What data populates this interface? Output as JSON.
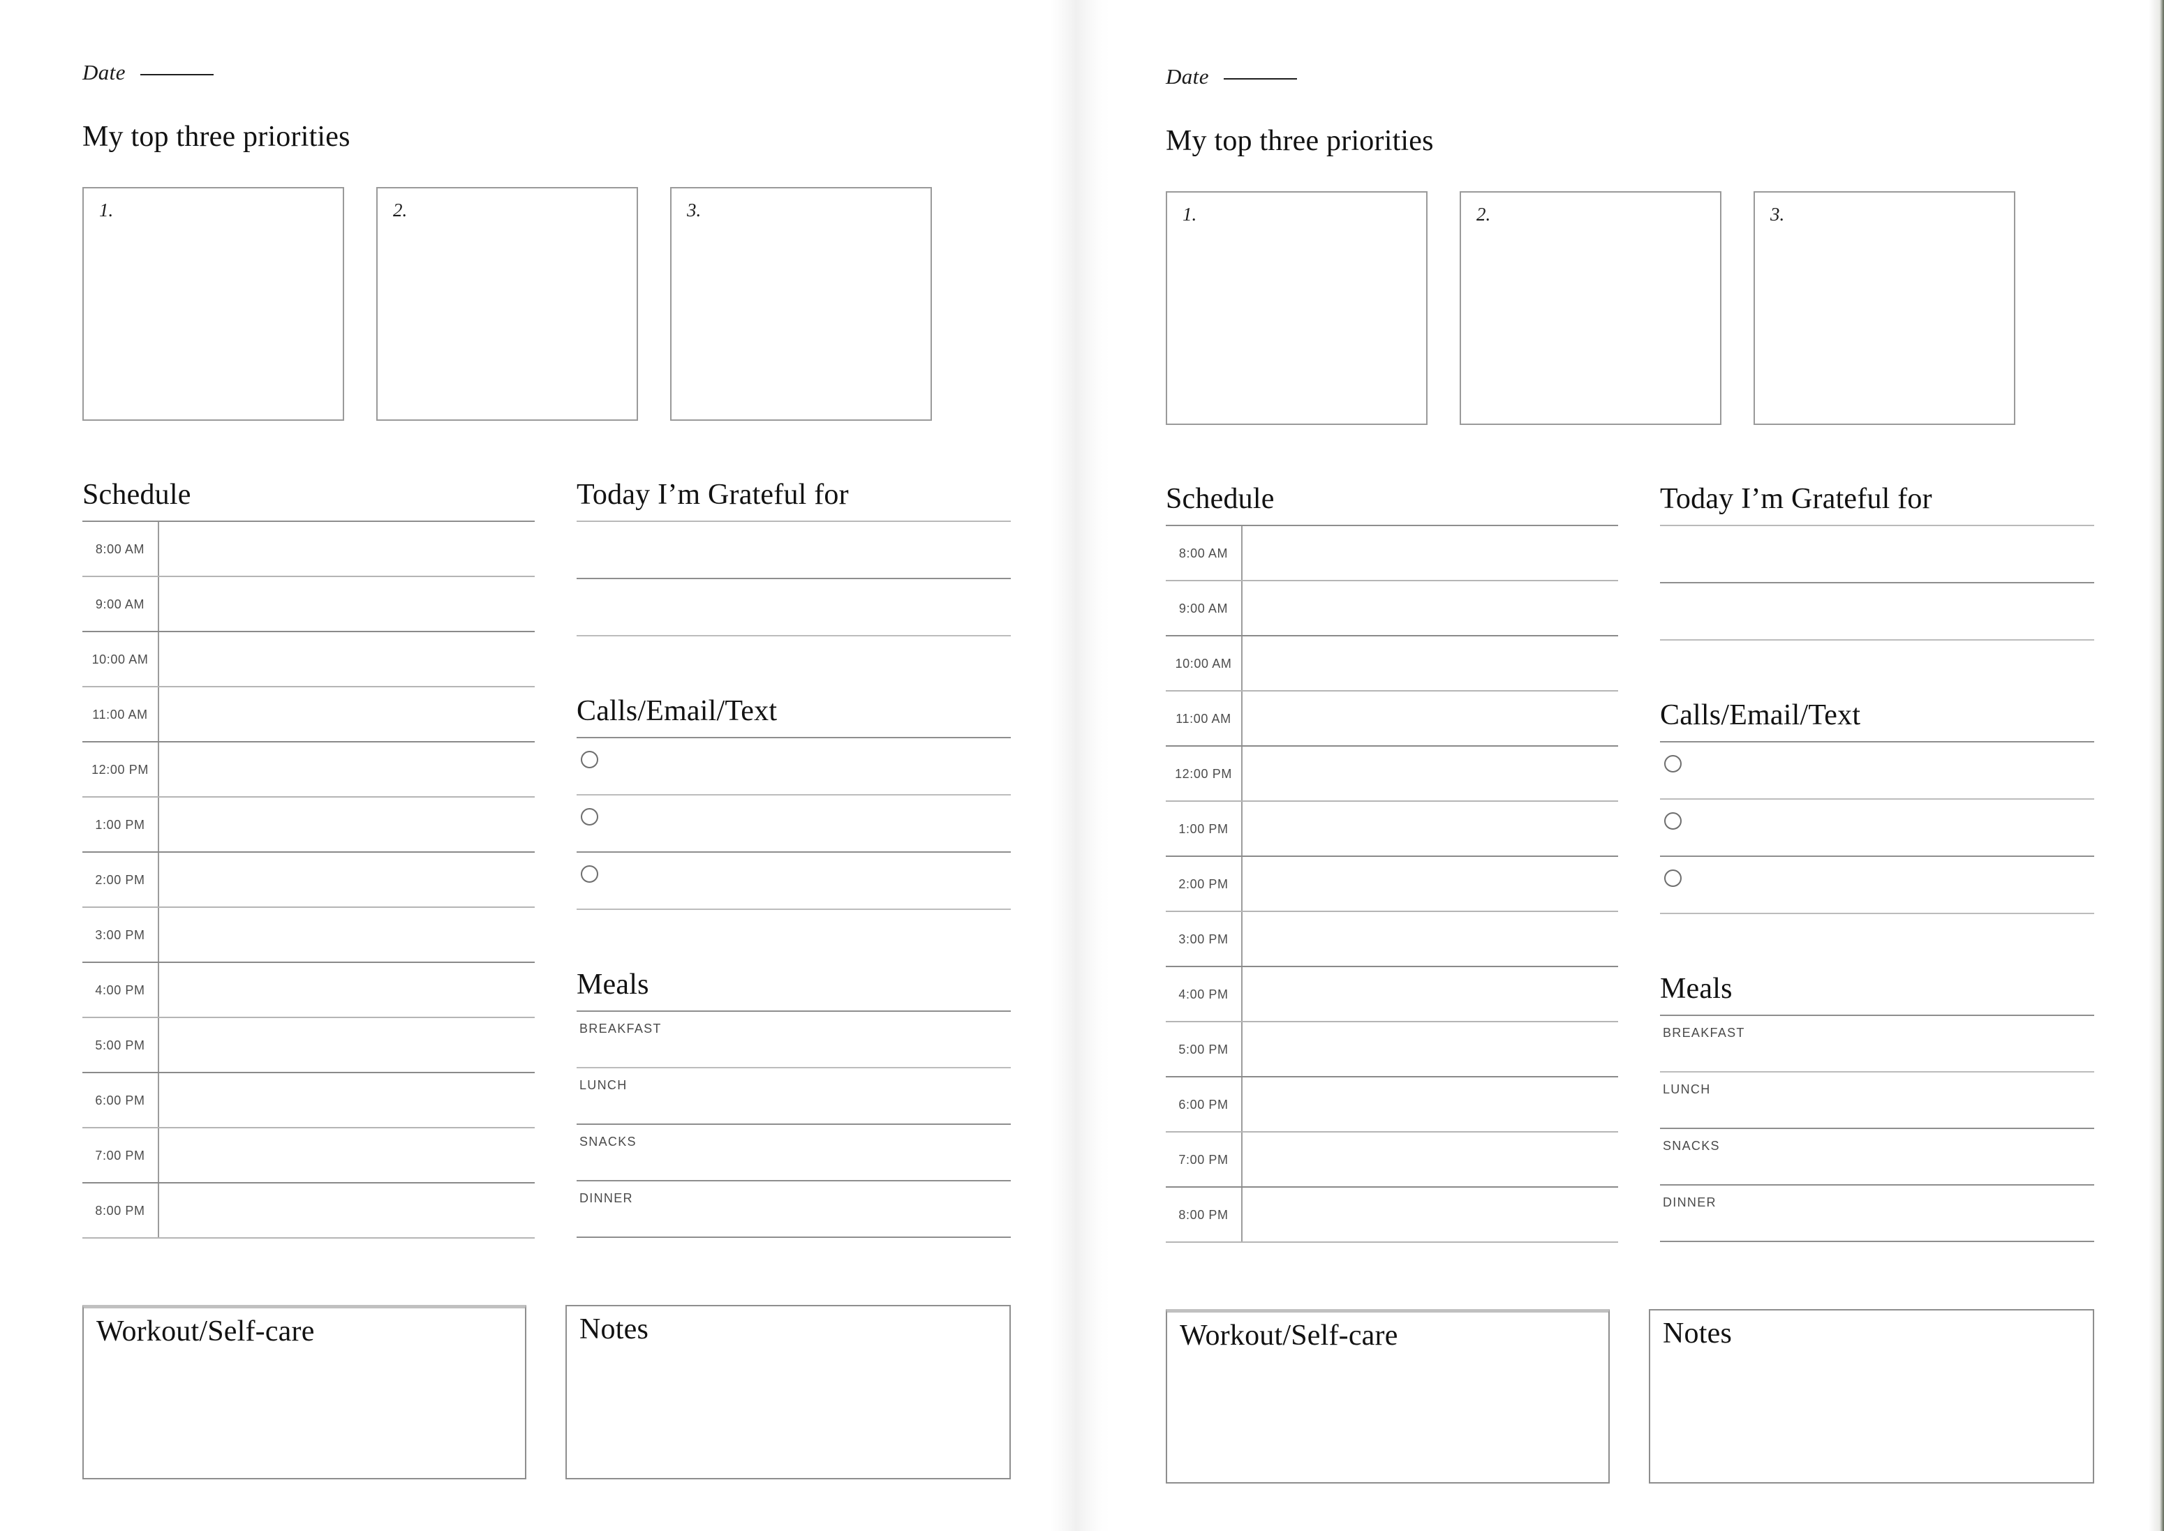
{
  "document": {
    "type": "daily-planner-spread",
    "pages": 2
  },
  "page": {
    "date": {
      "label": "Date",
      "value": ""
    },
    "priorities": {
      "title": "My top three priorities",
      "items": [
        {
          "number": "1.",
          "value": ""
        },
        {
          "number": "2.",
          "value": ""
        },
        {
          "number": "3.",
          "value": ""
        }
      ]
    },
    "schedule": {
      "title": "Schedule",
      "rows": [
        {
          "time": "8:00 AM",
          "value": ""
        },
        {
          "time": "9:00 AM",
          "value": ""
        },
        {
          "time": "10:00 AM",
          "value": ""
        },
        {
          "time": "11:00 AM",
          "value": ""
        },
        {
          "time": "12:00 PM",
          "value": ""
        },
        {
          "time": "1:00 PM",
          "value": ""
        },
        {
          "time": "2:00 PM",
          "value": ""
        },
        {
          "time": "3:00 PM",
          "value": ""
        },
        {
          "time": "4:00 PM",
          "value": ""
        },
        {
          "time": "5:00 PM",
          "value": ""
        },
        {
          "time": "6:00 PM",
          "value": ""
        },
        {
          "time": "7:00 PM",
          "value": ""
        },
        {
          "time": "8:00 PM",
          "value": ""
        }
      ]
    },
    "gratitude": {
      "title": "Today I’m Grateful for",
      "lines": [
        "",
        ""
      ]
    },
    "calls": {
      "title": "Calls/Email/Text",
      "items": [
        {
          "checked": false,
          "value": ""
        },
        {
          "checked": false,
          "value": ""
        },
        {
          "checked": false,
          "value": ""
        }
      ]
    },
    "meals": {
      "title": "Meals",
      "items": [
        {
          "label": "BREAKFAST",
          "value": ""
        },
        {
          "label": "LUNCH",
          "value": ""
        },
        {
          "label": "SNACKS",
          "value": ""
        },
        {
          "label": "DINNER",
          "value": ""
        }
      ]
    },
    "workout": {
      "title": "Workout/Self-care",
      "value": ""
    },
    "notes": {
      "title": "Notes",
      "value": ""
    }
  },
  "colors": {
    "paper": "#ffffff",
    "ink": "#121212",
    "rule_dark": "#8a8a8a",
    "rule_light": "#bcbcbc",
    "box_border": "#9a9a9a",
    "muted_text": "#4a4a4a",
    "edge_green": "#6d7566"
  }
}
